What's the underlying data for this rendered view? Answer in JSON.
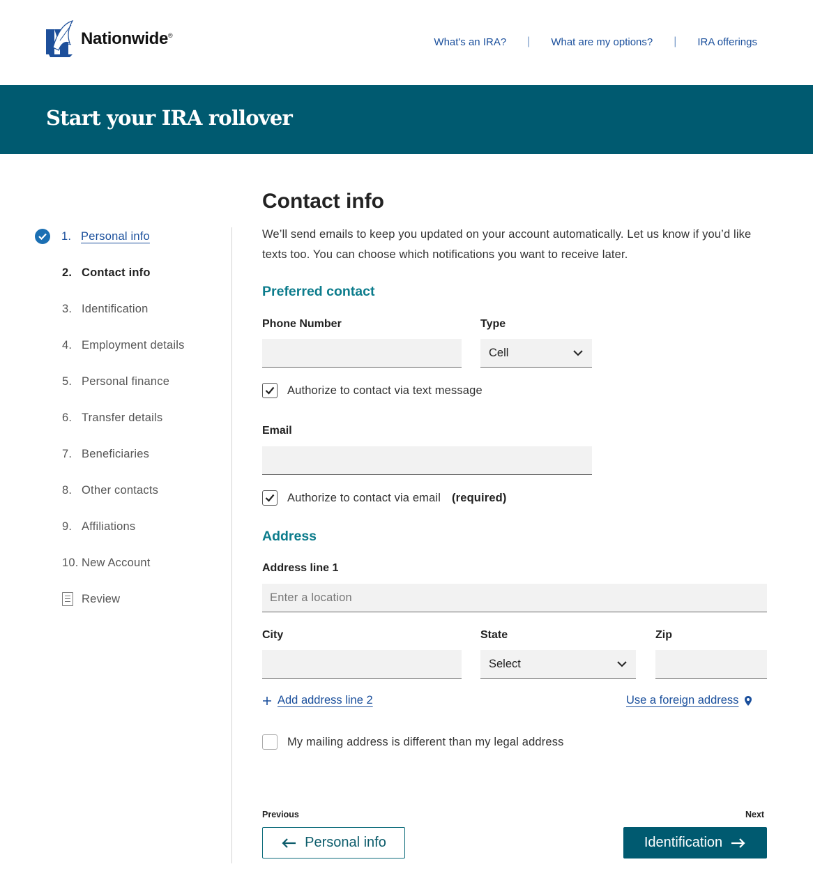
{
  "brand": {
    "name": "Nationwide",
    "reg": "®"
  },
  "topnav": [
    "What's an IRA?",
    "What are my options?",
    "IRA offerings"
  ],
  "banner": {
    "title": "Start your IRA rollover"
  },
  "steps": [
    {
      "num": "1.",
      "label": "Personal info",
      "state": "done"
    },
    {
      "num": "2.",
      "label": "Contact info",
      "state": "current"
    },
    {
      "num": "3.",
      "label": "Identification",
      "state": "upcoming"
    },
    {
      "num": "4.",
      "label": "Employment details",
      "state": "upcoming"
    },
    {
      "num": "5.",
      "label": "Personal finance",
      "state": "upcoming"
    },
    {
      "num": "6.",
      "label": "Transfer details",
      "state": "upcoming"
    },
    {
      "num": "7.",
      "label": "Beneficiaries",
      "state": "upcoming"
    },
    {
      "num": "8.",
      "label": "Other contacts",
      "state": "upcoming"
    },
    {
      "num": "9.",
      "label": "Affiliations",
      "state": "upcoming"
    },
    {
      "num": "10.",
      "label": "New Account",
      "state": "upcoming"
    },
    {
      "num": "",
      "label": "Review",
      "state": "review"
    }
  ],
  "main": {
    "title": "Contact info",
    "intro": "We’ll send emails to keep you updated on your account automatically. Let us know if you’d like texts too. You can choose which notifications you want to receive later.",
    "preferred": {
      "heading": "Preferred contact",
      "phone_label": "Phone Number",
      "phone_value": "",
      "type_label": "Type",
      "type_value": "Cell",
      "text_auth": "Authorize to contact via text message",
      "text_auth_checked": true,
      "email_label": "Email",
      "email_value": "",
      "email_auth": "Authorize to contact via email",
      "email_auth_checked": true,
      "email_required": "(required)"
    },
    "address": {
      "heading": "Address",
      "line1_label": "Address line 1",
      "line1_placeholder": "Enter a location",
      "city_label": "City",
      "state_label": "State",
      "state_value": "Select",
      "zip_label": "Zip",
      "add_line2": "Add address line 2",
      "foreign": "Use a foreign address",
      "mailing_diff": "My mailing address is different than my legal address",
      "mailing_diff_checked": false
    }
  },
  "nav": {
    "prev_caption": "Previous",
    "prev_label": "Personal info",
    "next_caption": "Next",
    "next_label": "Identification"
  },
  "colors": {
    "teal": "#005a70",
    "accent": "#0c7c8c",
    "link": "#1a4f9c",
    "check": "#1b6fb3"
  }
}
